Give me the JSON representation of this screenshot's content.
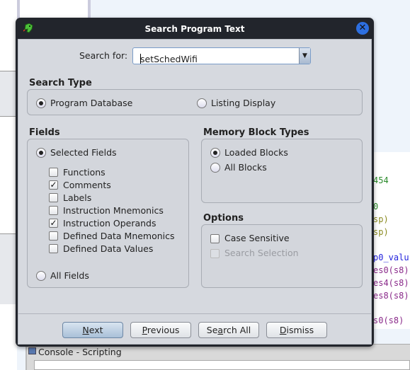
{
  "dialog": {
    "title": "Search Program Text"
  },
  "search": {
    "label": "Search for:",
    "value": "setSchedWifi"
  },
  "search_type": {
    "heading": "Search Type",
    "options": [
      {
        "label": "Program Database",
        "selected": true
      },
      {
        "label": "Listing Display",
        "selected": false
      }
    ]
  },
  "fields": {
    "heading": "Fields",
    "selected_fields": {
      "label": "Selected Fields",
      "selected": true
    },
    "all_fields": {
      "label": "All Fields",
      "selected": false
    },
    "items": [
      {
        "label": "Functions",
        "checked": false
      },
      {
        "label": "Comments",
        "checked": true
      },
      {
        "label": "Labels",
        "checked": false
      },
      {
        "label": "Instruction Mnemonics",
        "checked": false
      },
      {
        "label": "Instruction Operands",
        "checked": true
      },
      {
        "label": "Defined Data Mnemonics",
        "checked": false
      },
      {
        "label": "Defined Data Values",
        "checked": false
      }
    ]
  },
  "memory": {
    "heading": "Memory Block Types",
    "options": [
      {
        "label": "Loaded Blocks",
        "selected": true
      },
      {
        "label": "All Blocks",
        "selected": false
      }
    ]
  },
  "options": {
    "heading": "Options",
    "case_sensitive": {
      "label": "Case Sensitive",
      "checked": false
    },
    "search_selection": {
      "label": "Search Selection",
      "checked": false,
      "enabled": false
    }
  },
  "buttons": [
    {
      "label": "Next",
      "mnemonic": 0
    },
    {
      "label": "Previous",
      "mnemonic": 0
    },
    {
      "label": "Search All",
      "mnemonic": 2
    },
    {
      "label": "Dismiss",
      "mnemonic": 0
    }
  ],
  "background": {
    "console_title": "Console - Scripting",
    "code_fragments": [
      {
        "text": "454",
        "color": "#2a8a2a"
      },
      {
        "text": "0",
        "color": "#2a8a2a"
      },
      {
        "text": " sp)",
        "color": "#8a8a20"
      },
      {
        "text": " sp)",
        "color": "#8a8a20"
      },
      {
        "text": "p0_valu",
        "color": "#2222dd"
      },
      {
        "text": "es0(s8)",
        "color": "#8a2a8a"
      },
      {
        "text": "es4(s8)",
        "color": "#8a2a8a"
      },
      {
        "text": "es8(s8)",
        "color": "#8a2a8a"
      },
      {
        "text": "s0(s8)",
        "color": "#8a2a8a"
      }
    ]
  },
  "colors": {
    "title_bar": "#22252c",
    "close": "#2d6fe0",
    "dialog_bg": "#d6d9df"
  }
}
